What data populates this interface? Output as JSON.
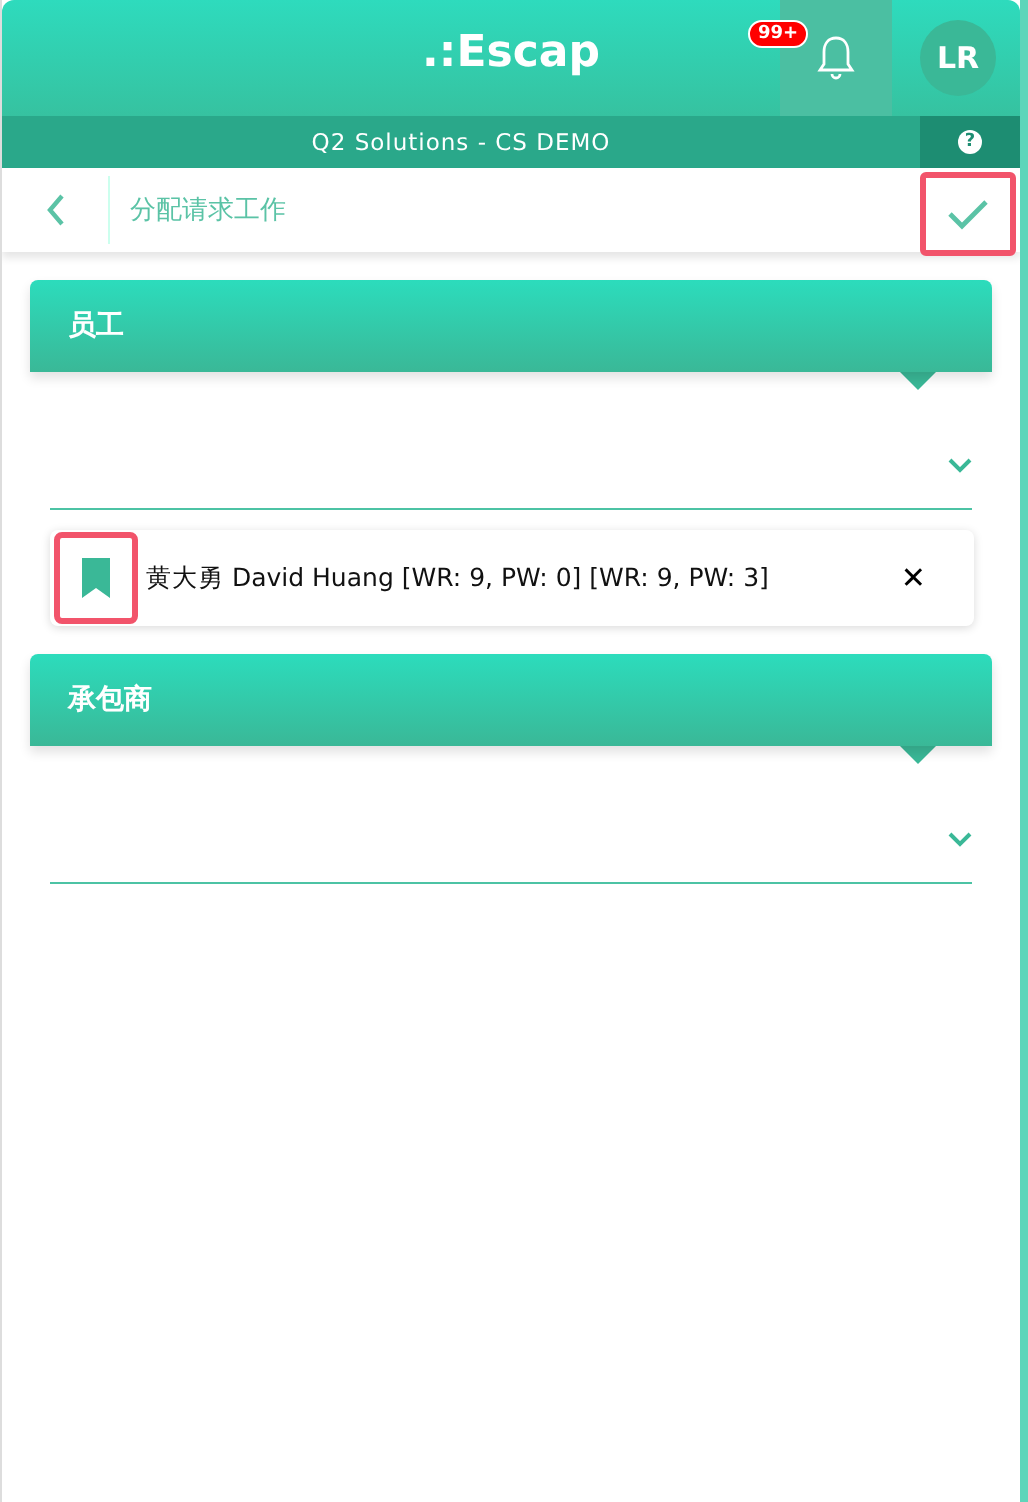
{
  "header": {
    "logo": ".:Escap",
    "notification_badge": "99+",
    "avatar": "LR"
  },
  "subheader": {
    "title": "Q2 Solutions - CS DEMO",
    "help": "?"
  },
  "toolbar": {
    "title": "分配请求工作",
    "confirm_highlighted": true
  },
  "sections": [
    {
      "title": "员工",
      "items": [
        {
          "name": "黄大勇 David Huang [WR: 9, PW: 0] [WR: 9, PW: 3]",
          "bookmark_highlighted": true,
          "remove_symbol": "✕"
        }
      ]
    },
    {
      "title": "承包商"
    }
  ]
}
